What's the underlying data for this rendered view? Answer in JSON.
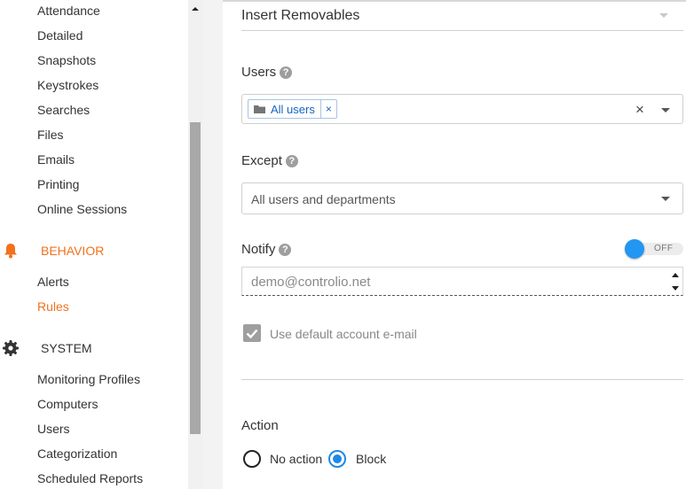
{
  "sidebar": {
    "report_items": [
      "Attendance",
      "Detailed",
      "Snapshots",
      "Keystrokes",
      "Searches",
      "Files",
      "Emails",
      "Printing",
      "Online Sessions"
    ],
    "behavior": {
      "title": "BEHAVIOR",
      "items": [
        "Alerts",
        "Rules"
      ],
      "active": "Rules"
    },
    "system": {
      "title": "SYSTEM",
      "items": [
        "Monitoring Profiles",
        "Computers",
        "Users",
        "Categorization",
        "Scheduled Reports"
      ]
    },
    "accent_color": "#f2711c"
  },
  "form": {
    "rule_type": {
      "value": "Insert Removables"
    },
    "users": {
      "label": "Users",
      "help": "?",
      "chip": "All users",
      "chip_remove": "×",
      "clear": "×"
    },
    "except": {
      "label": "Except",
      "help": "?",
      "placeholder": "All users and departments"
    },
    "notify": {
      "label": "Notify",
      "help": "?",
      "toggle_state": "OFF",
      "email": "demo@controlio.net"
    },
    "default_email": {
      "label": "Use default account e-mail",
      "checked": true
    },
    "action": {
      "label": "Action",
      "options": [
        "No action",
        "Block"
      ],
      "selected": "Block"
    }
  },
  "colors": {
    "primary": "#2196f3"
  }
}
